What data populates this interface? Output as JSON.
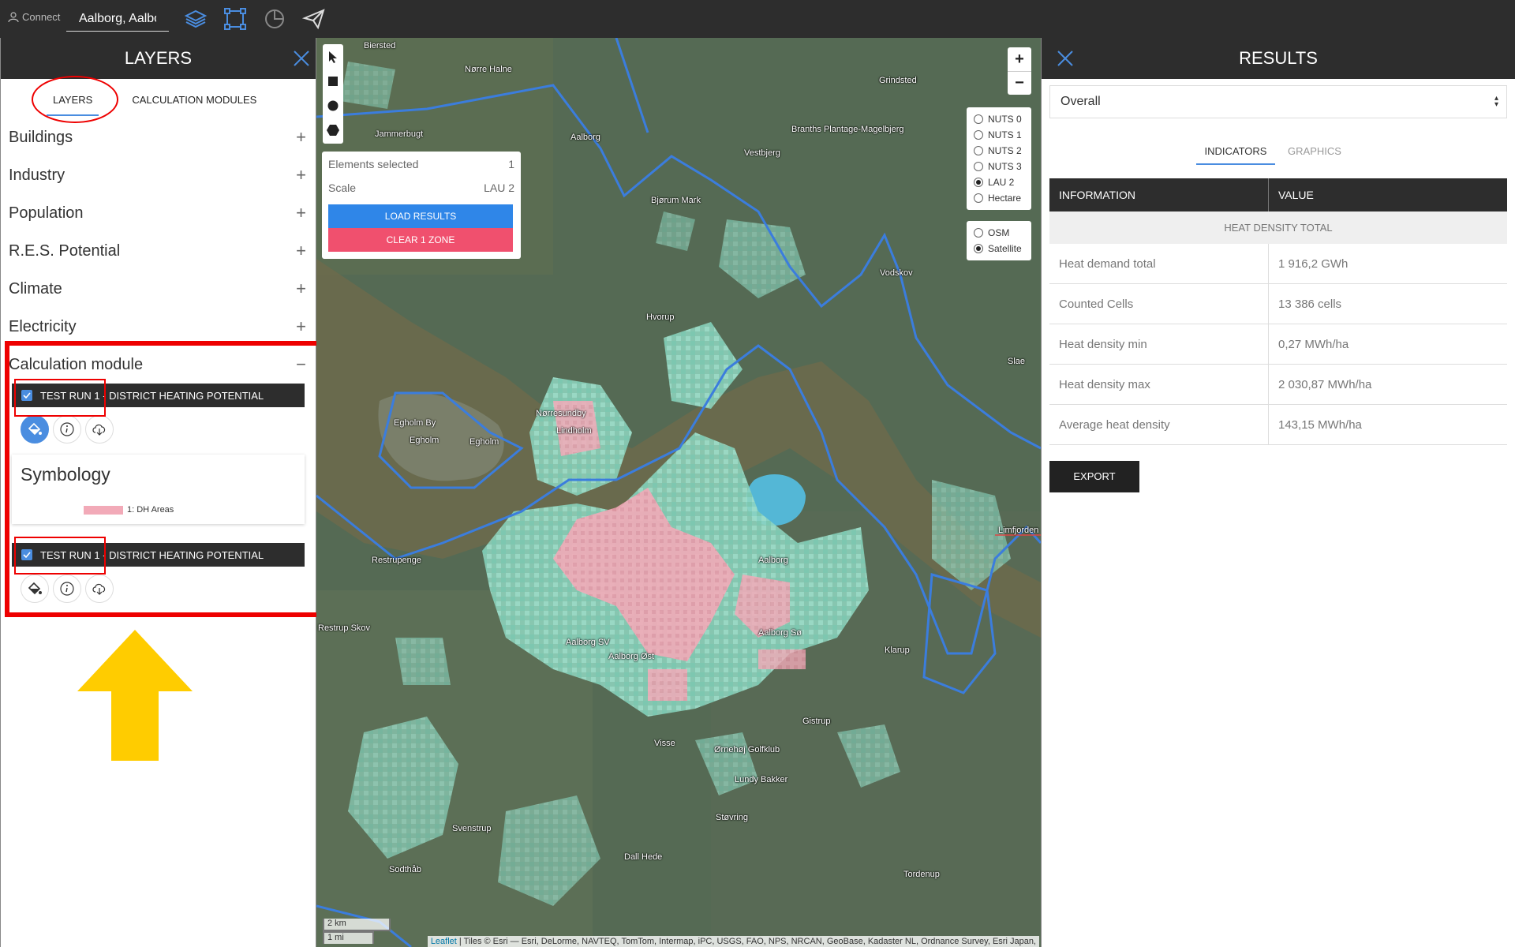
{
  "topbar": {
    "connect_label": "Connect",
    "search_value": "Aalborg, Aalborg"
  },
  "layers_panel": {
    "title": "LAYERS",
    "tabs": [
      {
        "label": "LAYERS",
        "active": true
      },
      {
        "label": "CALCULATION MODULES",
        "active": false
      }
    ],
    "categories": [
      {
        "label": "Buildings",
        "sign": "+"
      },
      {
        "label": "Industry",
        "sign": "+"
      },
      {
        "label": "Population",
        "sign": "+"
      },
      {
        "label": "R.E.S. Potential",
        "sign": "+"
      },
      {
        "label": "Climate",
        "sign": "+"
      },
      {
        "label": "Electricity",
        "sign": "+"
      },
      {
        "label": "Calculation module",
        "sign": "−"
      }
    ],
    "layer_items": [
      {
        "label": "TEST RUN 1 - DISTRICT HEATING POTENTIAL",
        "checked": true
      },
      {
        "label": "TEST RUN 1 - DISTRICT HEATING POTENTIAL",
        "checked": true
      }
    ],
    "symbology": {
      "title": "Symbology",
      "item_label": "1: DH Areas",
      "item_color": "#f2aab8"
    }
  },
  "map": {
    "selection": {
      "elements_label": "Elements selected",
      "elements_value": "1",
      "scale_label": "Scale",
      "scale_value": "LAU 2",
      "load_button": "LOAD RESULTS",
      "clear_button": "CLEAR 1 ZONE"
    },
    "zoom_in": "+",
    "zoom_out": "−",
    "nuts_options": [
      {
        "label": "NUTS 0",
        "selected": false
      },
      {
        "label": "NUTS 1",
        "selected": false
      },
      {
        "label": "NUTS 2",
        "selected": false
      },
      {
        "label": "NUTS 3",
        "selected": false
      },
      {
        "label": "LAU 2",
        "selected": true
      },
      {
        "label": "Hectare",
        "selected": false
      }
    ],
    "basemap_options": [
      {
        "label": "OSM",
        "selected": false
      },
      {
        "label": "Satellite",
        "selected": true
      }
    ],
    "scale_km": "2 km",
    "scale_mi": "1 mi",
    "attribution_link": "Leaflet",
    "attribution_text": "| Tiles © Esri — Esri, DeLorme, NAVTEQ, TomTom, Intermap, iPC, USGS, FAO, NPS, NRCAN, GeoBase, Kadaster NL, Ordnance Survey, Esri Japan,",
    "places": [
      "Biersted",
      "Nørre Halne",
      "Jammerbugt",
      "Aalborg",
      "Grindsted",
      "Branths Plantage-Magelbjerg",
      "Vestbjerg",
      "Bjørum Mark",
      "Vodskov",
      "Hvorup",
      "Egholm By",
      "Egholm",
      "Egholm",
      "Nørresundby",
      "Lindholm",
      "Aalborg",
      "Limfjorden",
      "Restrupenge",
      "Aalborg Øst",
      "Aalborg SV",
      "Aalborg Sø",
      "Klarup",
      "Svenstrup",
      "Gistrup",
      "Visse",
      "Ørnehøj Golfklub",
      "Lundy Bakker",
      "Støvring",
      "Dall Hede",
      "Sodthåb",
      "Tordenup",
      "Restrup Skov",
      "Slae"
    ],
    "colors": {
      "dh_area": "#f2aab8",
      "heat_density": "#8fd6c0",
      "boundary": "#3b7ddd",
      "load_button": "#2f86e8",
      "clear_button": "#f0506e"
    }
  },
  "results_panel": {
    "title": "RESULTS",
    "dropdown_value": "Overall",
    "tabs": [
      {
        "label": "INDICATORS",
        "active": true
      },
      {
        "label": "GRAPHICS",
        "active": false
      }
    ],
    "table": {
      "headers": [
        "INFORMATION",
        "VALUE"
      ],
      "section": "HEAT DENSITY TOTAL",
      "rows": [
        {
          "info": "Heat demand total",
          "value": "1 916,2 GWh"
        },
        {
          "info": "Counted Cells",
          "value": "13 386 cells"
        },
        {
          "info": "Heat density min",
          "value": "0,27 MWh/ha"
        },
        {
          "info": "Heat density max",
          "value": "2 030,87 MWh/ha"
        },
        {
          "info": "Average heat density",
          "value": "143,15 MWh/ha"
        }
      ]
    },
    "export_button": "EXPORT"
  },
  "annotations": {
    "highlight_color": "#ee0000",
    "arrow_color": "#ffcc00"
  }
}
